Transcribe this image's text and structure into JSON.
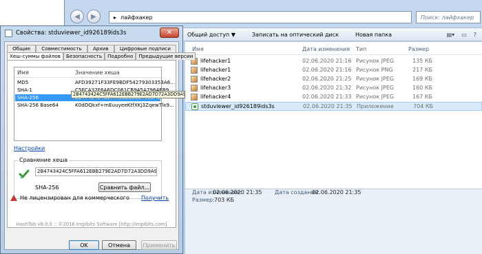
{
  "explorer": {
    "address_path": "лайфхакер",
    "search_placeholder": "Поиск: лайфхакер",
    "toolbar": [
      "Общий доступ ▼",
      "Записать на оптический диск",
      "Новая папка"
    ],
    "columns": {
      "name": "Имя",
      "date": "Дата изменения",
      "type": "Тип",
      "size": "Размер"
    },
    "files": [
      {
        "name": "lifehacker1",
        "date": "02.06.2020 21:16",
        "type": "Рисунок JPEG",
        "size": "135 КБ",
        "icon": "image-icon"
      },
      {
        "name": "lifehacker1",
        "date": "02.06.2020 21:16",
        "type": "Рисунок PNG",
        "size": "217 КБ",
        "icon": "image-icon"
      },
      {
        "name": "lifehacker2",
        "date": "02.06.2020 21:25",
        "type": "Рисунок JPEG",
        "size": "169 КБ",
        "icon": "image-icon"
      },
      {
        "name": "lifehacker3",
        "date": "02.06.2020 21:32",
        "type": "Рисунок JPEG",
        "size": "160 КБ",
        "icon": "image-icon"
      },
      {
        "name": "lifehacker4",
        "date": "02.06.2020 21:33",
        "type": "Рисунок JPEG",
        "size": "167 КБ",
        "icon": "image-icon"
      },
      {
        "name": "stduviewer_id926189ids3s",
        "date": "02.06.2020 21:35",
        "type": "Приложение",
        "size": "704 КБ",
        "icon": "app-icon"
      }
    ],
    "details": {
      "modified_label": "Дата изменения:",
      "modified_value": "02.06.2020 21:35",
      "created_label": "Дата создания:",
      "created_value": "02.06.2020 21:35",
      "size_label": "Размер:",
      "size_value": "703 КБ"
    }
  },
  "dialog": {
    "title": "Свойства: stduviewer_id926189ids3s",
    "tabs_row1": [
      "Общие",
      "Совместимость",
      "Архив",
      "Цифровые подписи"
    ],
    "tabs_row2": [
      "Хеш-суммы файлов",
      "Безопасность",
      "Подробно",
      "Предыдущие версии"
    ],
    "list_headers": {
      "name": "Имя",
      "value": "Значение хеша"
    },
    "hashes": [
      {
        "name": "MD5",
        "value": "AFD39271F33FE9BDF54279303353A6..."
      },
      {
        "name": "SHA-1",
        "value": "C5FCA32F6A6DC061CB945A7964EB9..."
      },
      {
        "name": "SHA-256",
        "value": "2B4743424C5FFA612EBB279E2AD7D..."
      },
      {
        "name": "SHA-256 Base64",
        "value": "K0dDQkxf+mEuuyeeKtfXKj3ZqewTlx9..."
      }
    ],
    "tooltip": "2B4743424C5FFA612EBB279E2AD7D72A3DD9A9EC13231F52FD26F52DEE61822F",
    "settings_link": "Настройки",
    "compare": {
      "legend": "Сравнение хеша",
      "input_value": "2B4743424C5FFA612EBB279E2AD7D72A3DD9A9EC13231",
      "algorithm": "SHA-256",
      "compare_button": "Сравнить файл..."
    },
    "license_text": "Не лицензирован для коммерческого",
    "buy_link": "Получить",
    "footer": "HashTab v6.0.0 :: ©2016 Implbits Software [http://implbits.com]",
    "buttons": {
      "ok": "OK",
      "cancel": "Отмена",
      "apply": "Применить"
    }
  }
}
